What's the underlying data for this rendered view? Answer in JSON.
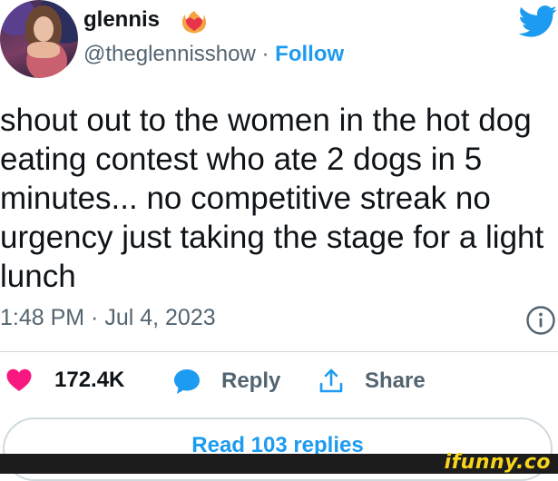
{
  "author": {
    "name": "glennis",
    "handle": "@theglennisshow",
    "separator": "·",
    "follow_label": "Follow"
  },
  "tweet": {
    "text": "shout out to the women in the hot dog\neating contest who ate 2 dogs in 5\nminutes... no competitive streak no\nurgency just taking the stage for a light\nlunch",
    "timestamp": "1:48 PM · Jul 4, 2023"
  },
  "actions": {
    "like_count": "172.4K",
    "reply_label": "Reply",
    "share_label": "Share"
  },
  "read_replies_label": "Read 103 replies",
  "watermark": "ifunny.co",
  "colors": {
    "accent": "#1d9bf0",
    "like": "#f91880",
    "text": "#0f1419",
    "secondary": "#536471",
    "divider": "#cfd9de"
  },
  "icons": [
    "fire-heart-emoji-icon",
    "twitter-bird-icon",
    "info-icon",
    "heart-icon",
    "reply-bubble-icon",
    "share-icon"
  ]
}
